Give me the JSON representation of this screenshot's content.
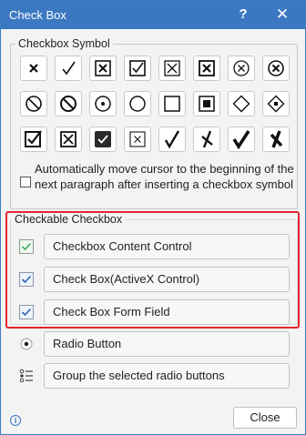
{
  "window": {
    "title": "Check Box",
    "help_glyph": "?",
    "close_glyph": "✕"
  },
  "symbols": {
    "group_label": "Checkbox Symbol",
    "rows": [
      [
        "cross",
        "check",
        "boxed-cross",
        "boxed-check",
        "boxed-x-thin",
        "boxed-x-thick",
        "circled-x",
        "circled-x-bold"
      ],
      [
        "circle-slash",
        "circle-slash-bold",
        "circled-dot",
        "empty-circle",
        "empty-square",
        "filled-square-boxed",
        "diamond",
        "diamond-dot"
      ],
      [
        "boxed-check-bold",
        "boxed-x-bold",
        "filled-box-check",
        "boxed-x-small",
        "check-bold",
        "x-bold",
        "check-heavy",
        "x-heavy"
      ]
    ]
  },
  "auto_move": {
    "checked": false,
    "text": "Automatically move cursor to the beginning of the next paragraph after inserting a checkbox symbol"
  },
  "checkable": {
    "group_label": "Checkable Checkbox",
    "items": [
      {
        "label": "Checkbox Content Control",
        "icon": "green-check-icon"
      },
      {
        "label": "Check Box(ActiveX Control)",
        "icon": "blue-check-icon"
      },
      {
        "label": "Check Box Form Field",
        "icon": "blue-check-icon"
      }
    ]
  },
  "radio": {
    "items": [
      {
        "label": "Radio Button",
        "icon": "radio-icon"
      },
      {
        "label": "Group the selected radio buttons",
        "icon": "list-group-icon"
      }
    ]
  },
  "footer": {
    "close_label": "Close",
    "info_glyph": "i"
  },
  "colors": {
    "titlebar": "#3b78c2",
    "highlight": "#e8232f"
  }
}
